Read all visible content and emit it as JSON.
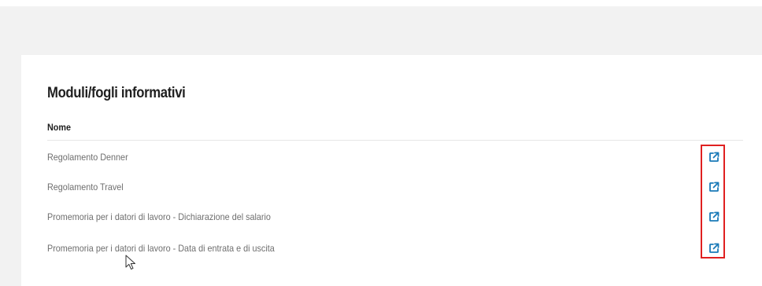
{
  "section": {
    "title": "Moduli/fogli informativi",
    "column_header": "Nome"
  },
  "documents": [
    {
      "label": "Regolamento Denner",
      "link_icon": "external-link-icon"
    },
    {
      "label": "Regolamento Travel",
      "link_icon": "external-link-icon"
    },
    {
      "label": "Promemoria per i datori di lavoro - Dichiarazione del salario",
      "link_icon": "external-link-icon"
    },
    {
      "label": "Promemoria per i datori di lavoro - Data di entrata e di uscita",
      "link_icon": "external-link-icon"
    }
  ],
  "colors": {
    "accent_link": "#1a7ab8",
    "highlight": "#e02020",
    "text_primary": "#1f1f1f",
    "text_secondary": "#6e6e6e"
  }
}
